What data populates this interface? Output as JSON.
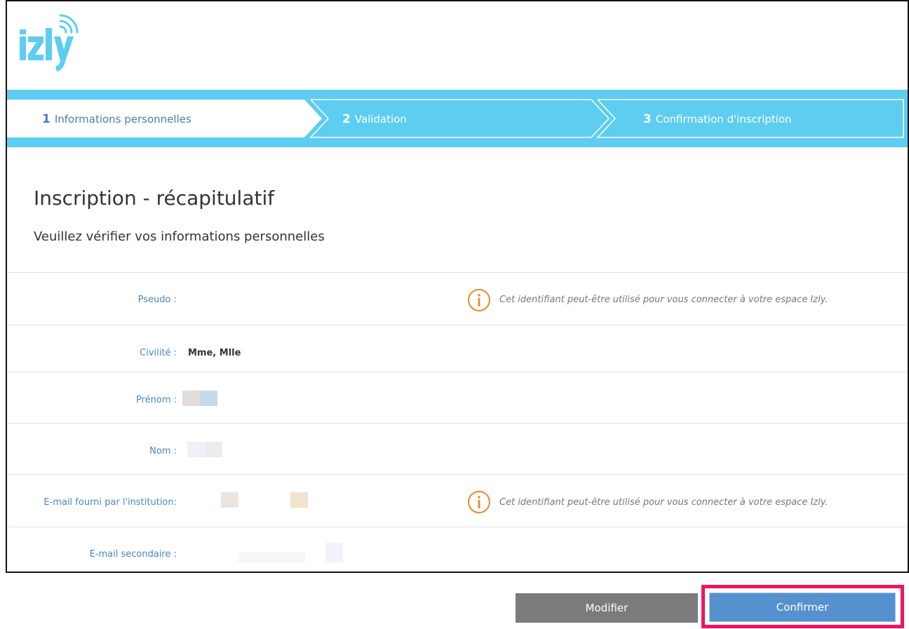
{
  "brand": {
    "logo_text": "izly"
  },
  "steps": [
    {
      "num": "1",
      "label": "Informations personnelles",
      "active": true
    },
    {
      "num": "2",
      "label": "Validation",
      "active": false
    },
    {
      "num": "3",
      "label": "Confirmation d'inscription",
      "active": false
    }
  ],
  "page": {
    "title": "Inscription - récapitulatif",
    "subtitle": "Veuillez vérifier vos informations personnelles"
  },
  "fields": {
    "pseudo": {
      "label": "Pseudo :",
      "info": "Cet identifiant peut-être utilisé pour vous connecter à votre espace Izly."
    },
    "civilite": {
      "label": "Civilité :",
      "value": "Mme, Mlle"
    },
    "prenom": {
      "label": "Prénom :"
    },
    "nom": {
      "label": "Nom :"
    },
    "email_institution": {
      "label": "E-mail fourni par l'institution:",
      "info": "Cet identifiant peut-être utilisé pour vous connecter à votre espace Izly."
    },
    "email_secondaire": {
      "label": "E-mail secondaire :"
    }
  },
  "actions": {
    "modify_label": "Modifier",
    "confirm_label": "Confirmer"
  },
  "colors": {
    "stepbar": "#5dcdf1",
    "label_blue": "#4a86c5",
    "info_orange": "#f08a24",
    "confirm_button": "#5591cf",
    "modify_button": "#7b7b7b",
    "highlight": "#f0145e"
  }
}
